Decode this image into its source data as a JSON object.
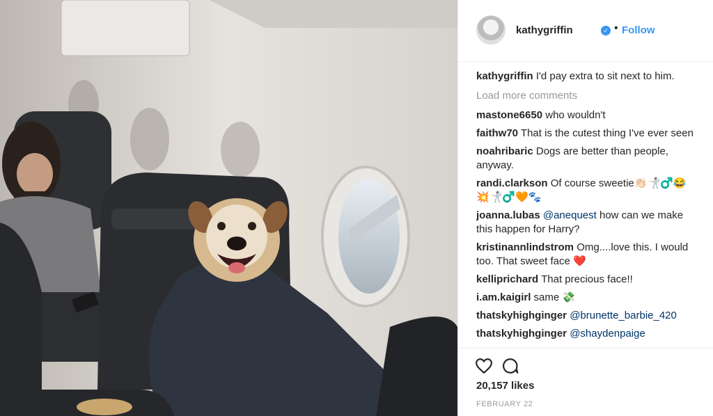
{
  "post": {
    "username": "kathygriffin",
    "follow_label": "Follow",
    "separator": "•",
    "caption": {
      "user": "kathygriffin",
      "text": "I'd pay extra to sit next to him."
    },
    "load_more": "Load more comments",
    "comments": [
      {
        "user": "mastone6650",
        "text": "who wouldn't"
      },
      {
        "user": "faithw70",
        "text": "That is the cutest thing I've ever seen"
      },
      {
        "user": "noahribaric",
        "text": "Dogs are better than people, anyway."
      },
      {
        "user": "randi.clarkson",
        "text": "Of course sweetie👏🏻🤺♂️😂💥🤺♂️🧡🐾"
      },
      {
        "user": "joanna.lubas",
        "mention": "@anequest",
        "text": "how can we make this happen for Harry?"
      },
      {
        "user": "kristinannlindstrom",
        "text": "Omg....love this. I would too. That sweet face ❤️"
      },
      {
        "user": "kelliprichard",
        "text": "That precious face!!"
      },
      {
        "user": "i.am.kaigirl",
        "text": "same 💸"
      },
      {
        "user": "thatskyhighginger",
        "mention": "@brunette_barbie_420",
        "text": ""
      },
      {
        "user": "thatskyhighginger",
        "mention": "@shaydenpaige",
        "text": ""
      }
    ],
    "likes": "20,157 likes",
    "date": "FEBRUARY 22"
  },
  "icons": {
    "like": "heart-icon",
    "comment": "comment-bubble-icon",
    "verified": "verified-badge-icon"
  },
  "colors": {
    "link": "#3897f0",
    "mention": "#003569",
    "muted": "#999999"
  }
}
